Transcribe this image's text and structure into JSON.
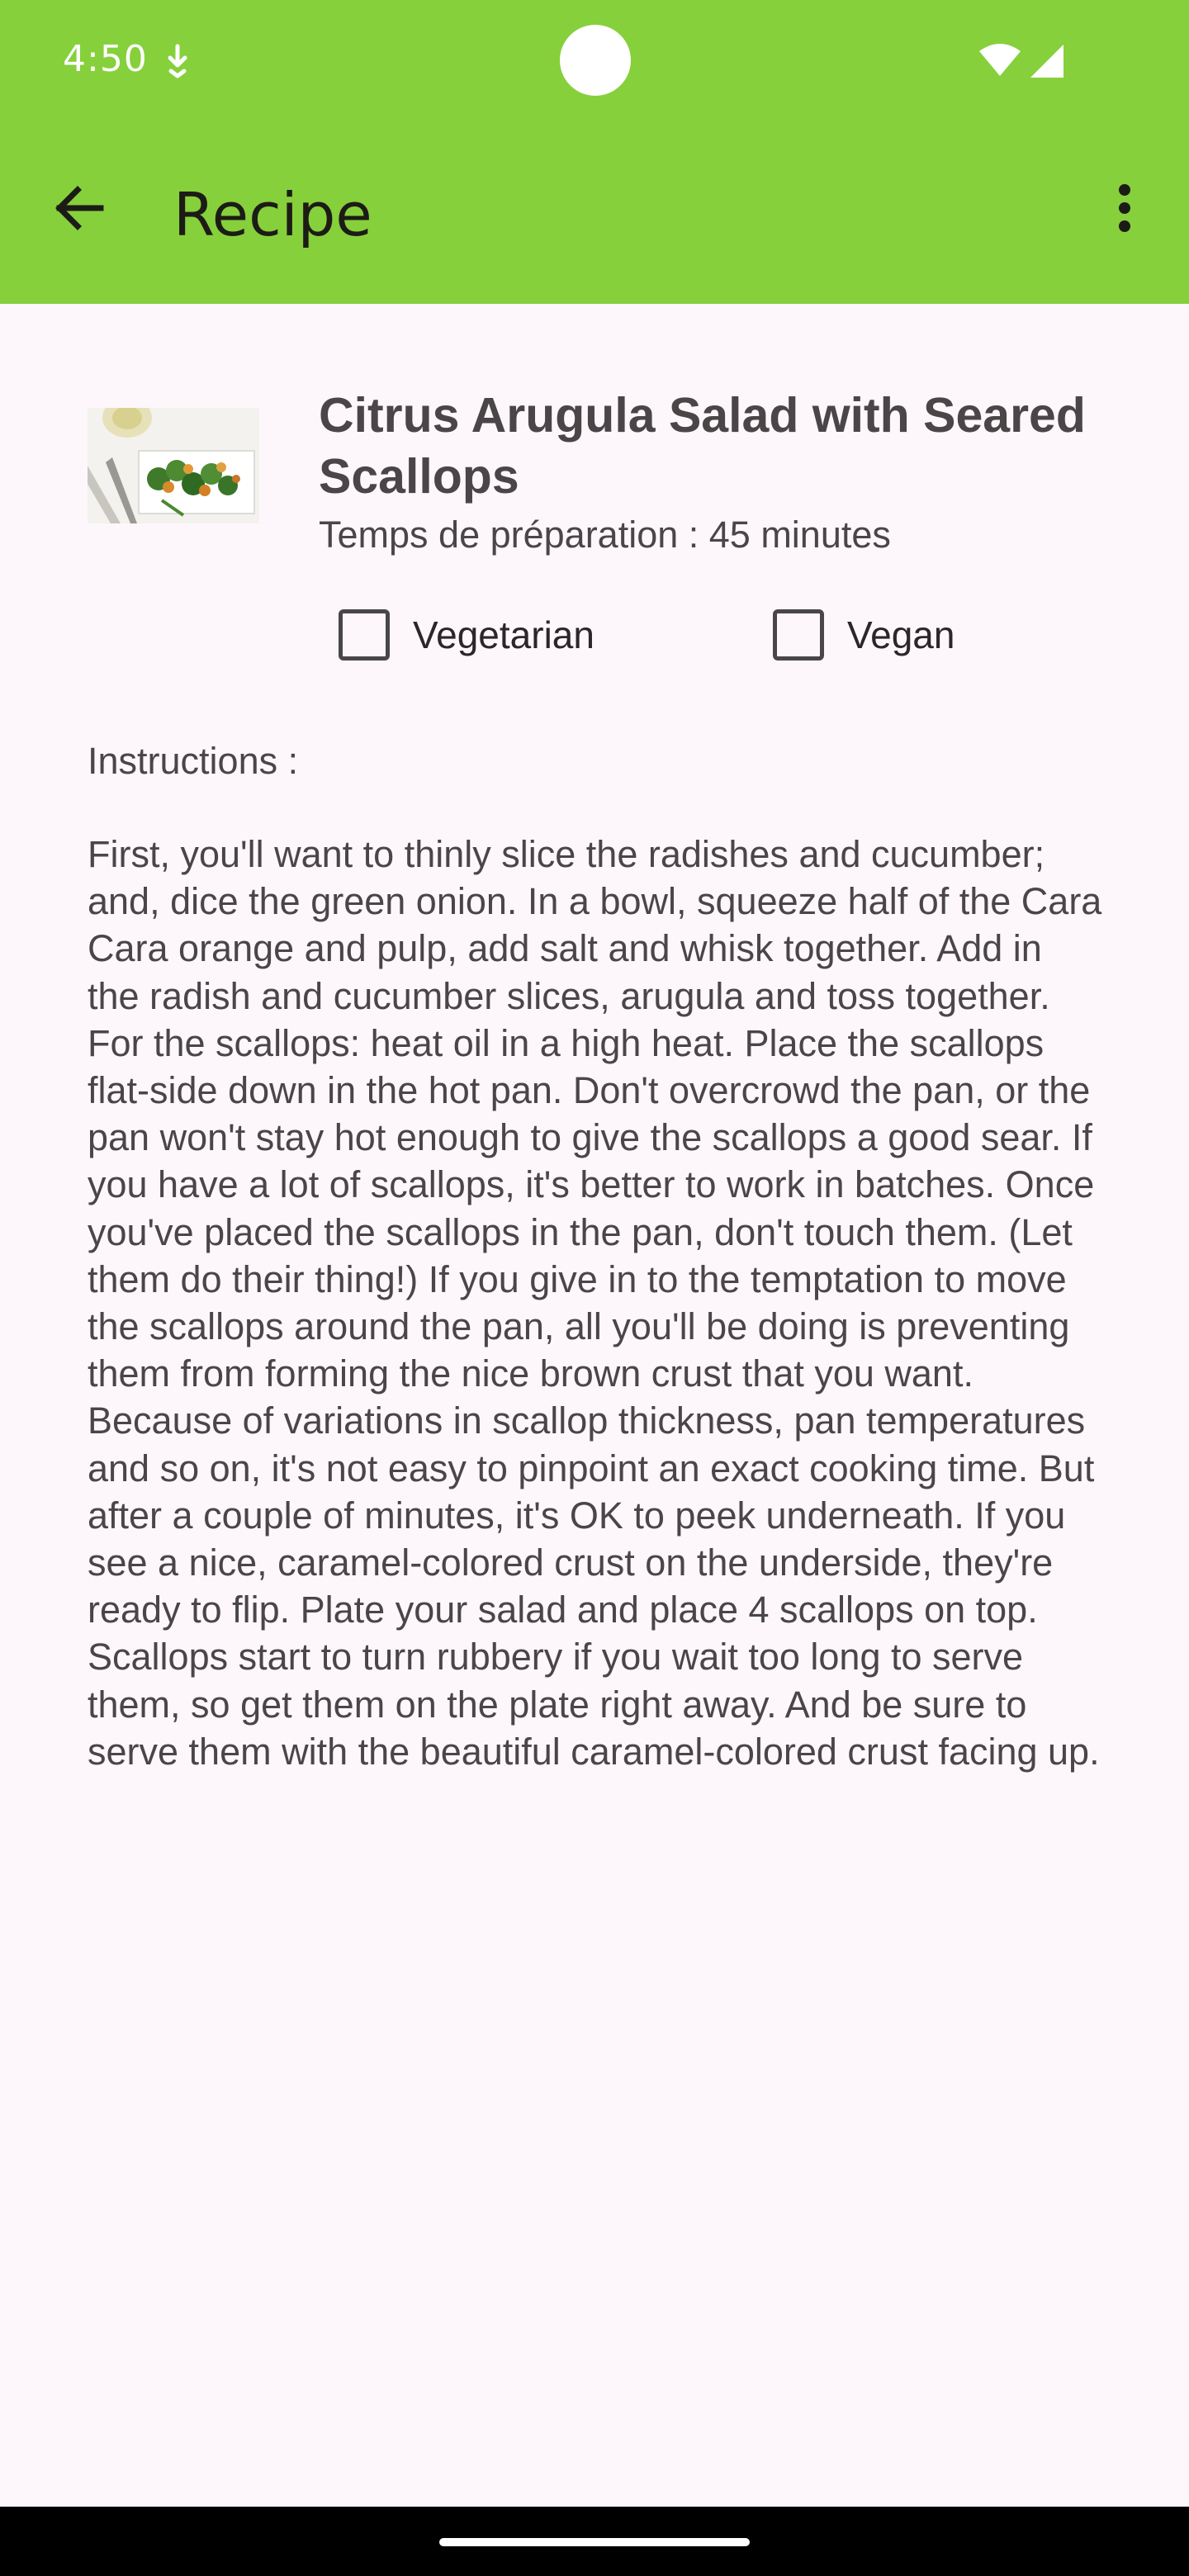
{
  "status_bar": {
    "time": "4:50",
    "notification_icon": "download-icon",
    "wifi_icon": "wifi-icon",
    "signal_icon": "cellular-signal-icon"
  },
  "toolbar": {
    "title": "Recipe",
    "back_icon": "arrow-back-icon",
    "menu_icon": "more-vert-icon",
    "background_color": "#86d03c"
  },
  "recipe": {
    "title": "Citrus Arugula Salad with Seared Scallops",
    "prep_time": "Temps de préparation : 45 minutes",
    "vegetarian_label": "Vegetarian",
    "vegetarian_checked": false,
    "vegan_label": "Vegan",
    "vegan_checked": false,
    "instructions_label": "Instructions :",
    "instructions": "First, you'll want to thinly slice the radishes and cucumber; and, dice the green onion. In a bowl, squeeze half of the Cara Cara orange and pulp, add salt and whisk together. Add in the radish and cucumber slices, arugula and toss together. For the scallops: heat oil in a high heat. Place the scallops flat-side down in the hot pan. Don't overcrowd the pan, or the pan won't stay hot enough to give the scallops a good sear. If you have a lot of scallops, it's better to work in batches. Once you've placed the scallops in the pan, don't touch them. (Let them do their thing!) If you give in to the temptation to move the scallops around the pan, all you'll be doing is preventing them from forming the nice brown crust that you want. Because of variations in scallop thickness, pan temperatures and so on, it's not easy to pinpoint an exact cooking time. But after a couple of minutes, it's OK to peek underneath. If you see a nice, caramel-colored crust on the underside, they're ready to flip. Plate your salad and place 4 scallops on top. Scallops start to turn rubbery if you wait too long to serve them, so get them on the plate right away. And be sure to serve them with the beautiful caramel-colored crust facing up."
  }
}
